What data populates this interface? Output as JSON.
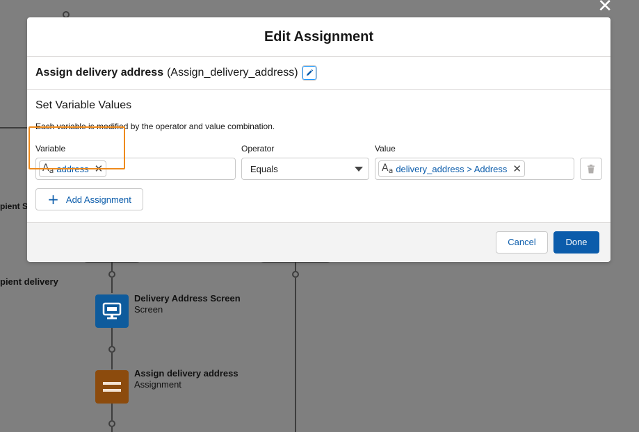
{
  "background": {
    "left_node_partial_1": "pient Sc",
    "left_node_partial_2": "pient delivery",
    "screen_node": {
      "title": "Delivery Address Screen",
      "subtitle": "Screen"
    },
    "assign_node": {
      "title": "Assign delivery address",
      "subtitle": "Assignment"
    },
    "close_icon": "close-icon"
  },
  "modal": {
    "title": "Edit Assignment",
    "element_label": "Assign delivery address",
    "element_api_name": "(Assign_delivery_address)",
    "section_title": "Set Variable Values",
    "section_description": "Each variable is modified by the operator and value combination.",
    "columns": {
      "variable": "Variable",
      "operator": "Operator",
      "value": "Value"
    },
    "row": {
      "variable_value": "address",
      "operator_value": "Equals",
      "value_value": "delivery_address > Address"
    },
    "add_assignment_label": "Add Assignment",
    "cancel_label": "Cancel",
    "done_label": "Done"
  },
  "colors": {
    "brand": "#0b5cab",
    "highlight": "#ee8a1c",
    "screen_node": "#0e5b9c",
    "assign_node": "#8c4b0d"
  }
}
